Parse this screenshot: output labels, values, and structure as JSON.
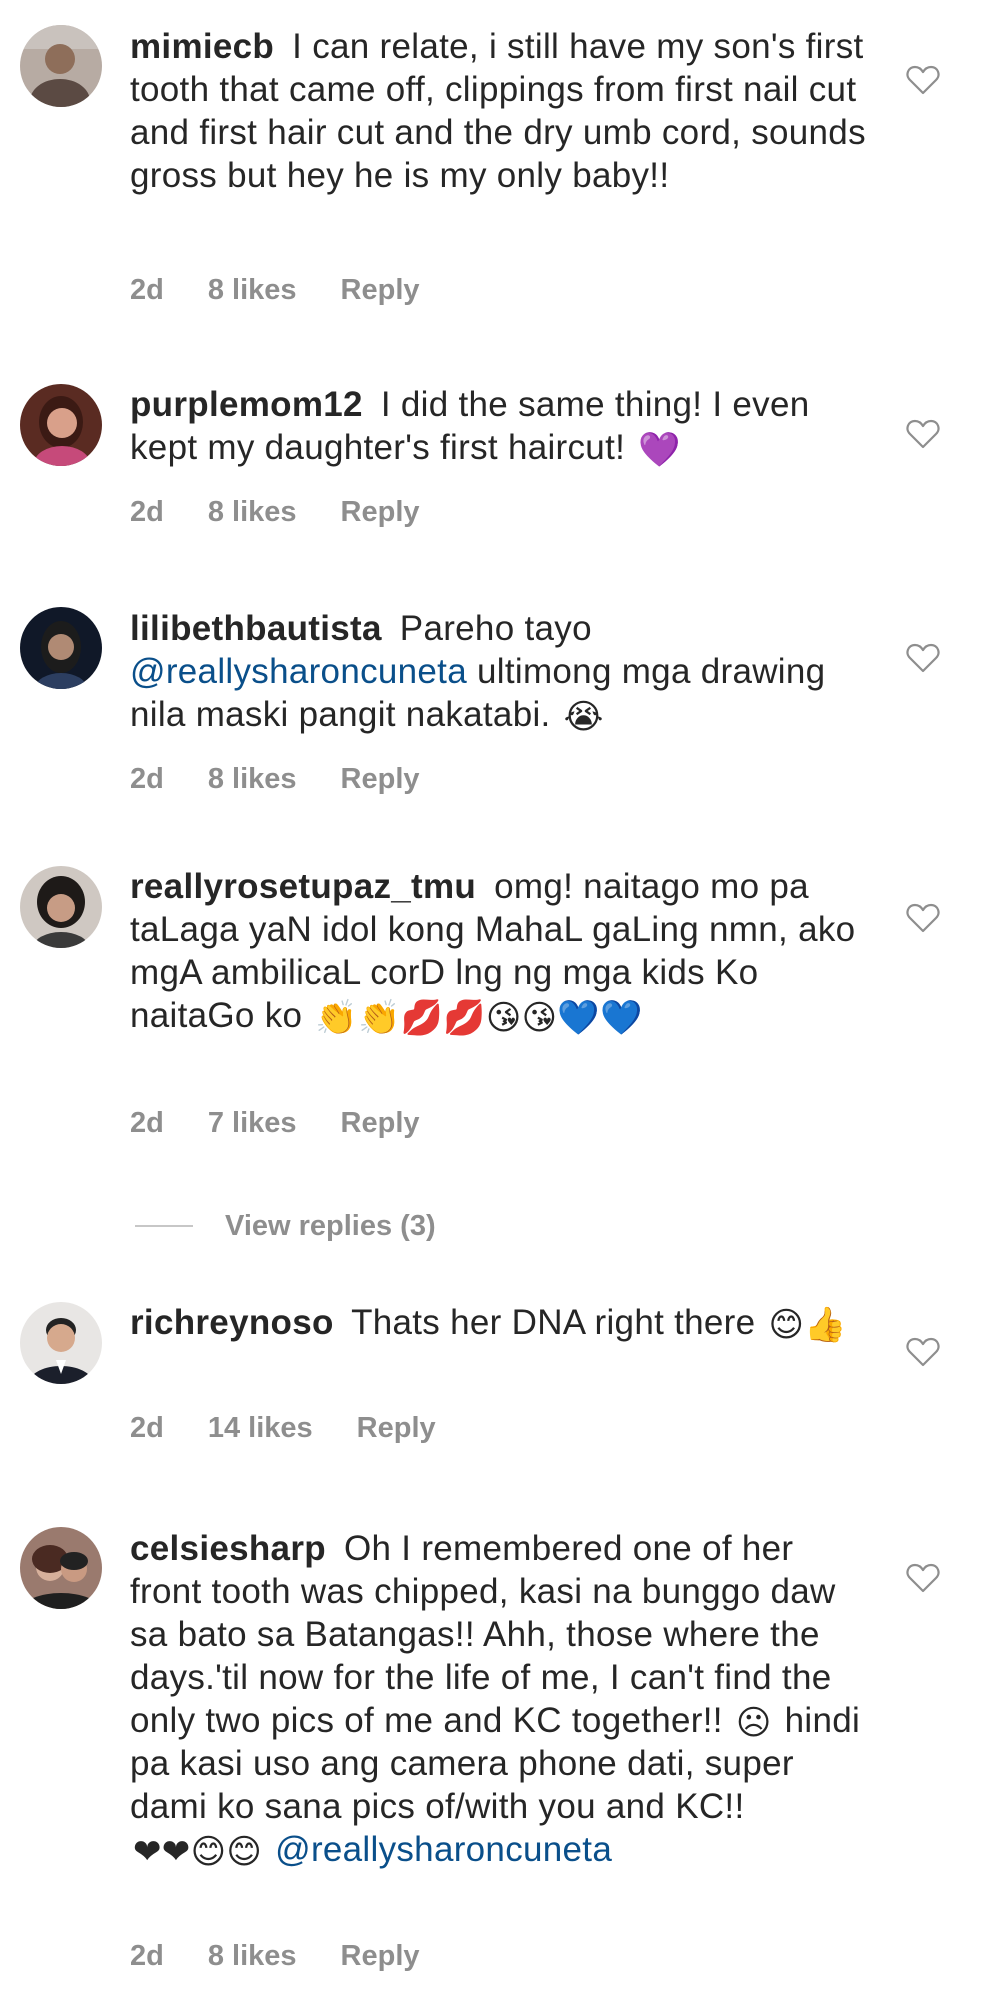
{
  "colors": {
    "text": "#262626",
    "muted": "#8e8e8e",
    "mention": "#0a4f8a"
  },
  "icons": {
    "like": "heart-outline-icon"
  },
  "comments": [
    {
      "username": "mimiecb",
      "text": "I can relate, i still have my son's first tooth that came off, clippings from first nail cut and  first hair cut and the dry umb cord, sounds gross but hey  he is my only baby!!",
      "time": "2d",
      "likes": "8 likes",
      "reply": "Reply"
    },
    {
      "username": "purplemom12",
      "text": "I  did the same thing! I even kept my daughter's first haircut!",
      "emoji": "💜",
      "time": "2d",
      "likes": "8 likes",
      "reply": "Reply"
    },
    {
      "username": "lilibethbautista",
      "text_before": "Pareho tayo",
      "mention": "@reallysharoncuneta",
      "text_after": "ultimong mga drawing nila maski pangit nakatabi.",
      "emoji": "😭",
      "time": "2d",
      "likes": "8 likes",
      "reply": "Reply"
    },
    {
      "username": "reallyrosetupaz_tmu",
      "text": "omg! naitago mo pa taLaga yaN idol kong MahaL gaLing nmn,  ako mgA ambilicaL corD lng ng mga kids Ko naitaGo ko",
      "emoji": "👏👏💋💋😘😘💙💙",
      "time": "2d",
      "likes": "7 likes",
      "reply": "Reply",
      "view_replies": "View replies (3)"
    },
    {
      "username": "richreynoso",
      "text": "Thats her DNA right there",
      "emoji": "😊👍",
      "time": "2d",
      "likes": "14 likes",
      "reply": "Reply"
    },
    {
      "username": "celsiesharp",
      "text": "Oh I remembered one of her front tooth was chipped, kasi na bunggo daw sa bato sa Batangas!! Ahh, those where the days.'til now for the life of me, I can't find the only two pics of me and KC together!!",
      "emoji_mid": "☹",
      "text_mid": "hindi pa kasi uso ang camera phone dati, super dami ko sana pics of/with you and KC!!",
      "emoji": "❤❤😊😊",
      "mention": "@reallysharoncuneta",
      "time": "2d",
      "likes": "8 likes",
      "reply": "Reply"
    }
  ]
}
